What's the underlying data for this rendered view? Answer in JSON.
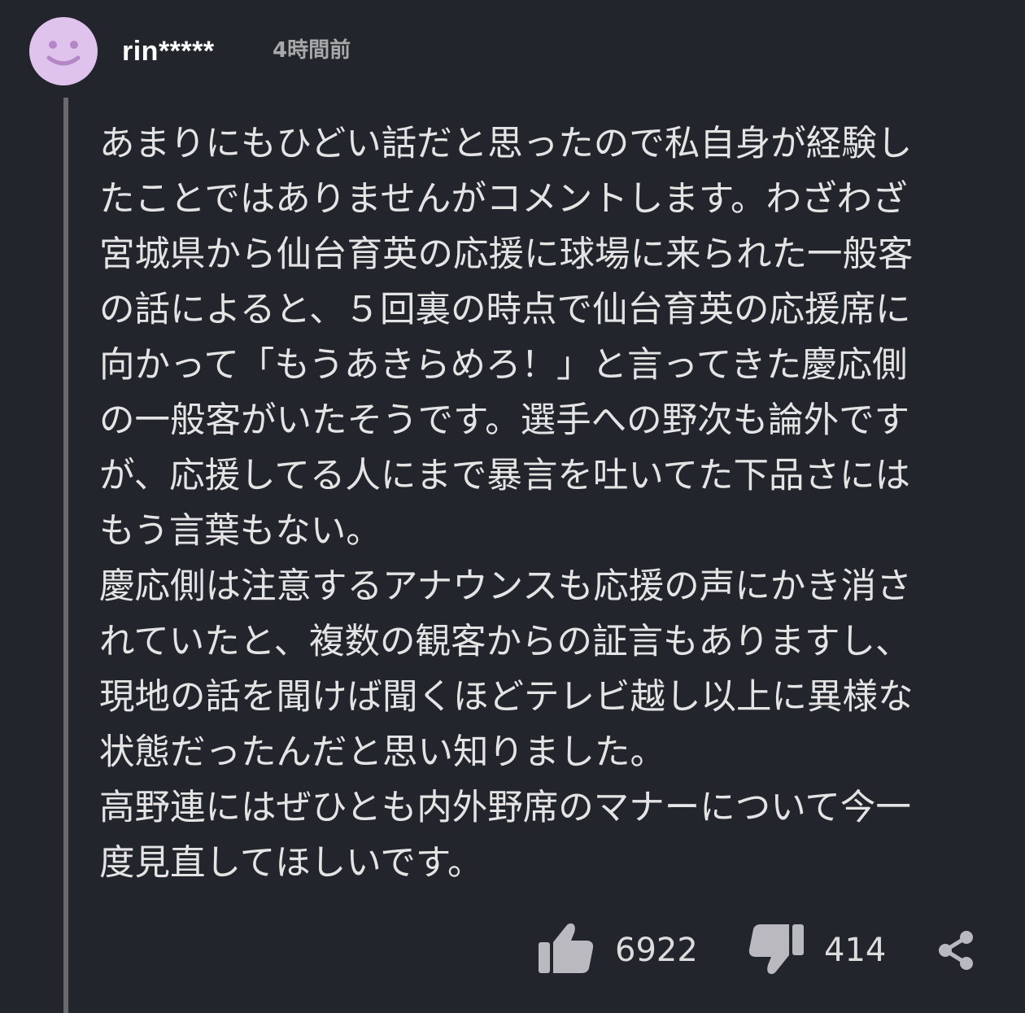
{
  "comment": {
    "author": "rin*****",
    "posted": "4時間前",
    "body_lines": [
      "あまりにもひどい話だと思ったので私自身が経験し",
      "たことではありませんがコメントします。わざわざ",
      "宮城県から仙台育英の応援に球場に来られた一般客",
      "の話によると、５回裏の時点で仙台育英の応援席に",
      "向かって「もうあきらめろ！」と言ってきた慶応側",
      "の一般客がいたそうです。選手への野次も論外です",
      "が、応援してる人にまで暴言を吐いてた下品さには",
      "もう言葉もない。",
      "慶応側は注意するアナウンスも応援の声にかき消さ",
      "れていたと、複数の観客からの証言もありますし、",
      "現地の話を聞けば聞くほどテレビ越し以上に異様な",
      "状態だったんだと思い知りました。",
      "高野連にはぜひとも内外野席のマナーについて今一",
      "度見直してほしいです。"
    ],
    "likes": "6922",
    "dislikes": "414"
  },
  "icons": {
    "avatar": "smiley-avatar",
    "like": "thumbs-up-icon",
    "dislike": "thumbs-down-icon",
    "share": "share-icon"
  },
  "colors": {
    "background": "#22252b",
    "avatar": "#e0c3ec",
    "avatar_face": "#b586c6",
    "thread_line": "#6a6a6e",
    "icon": "#b9b9bf"
  }
}
